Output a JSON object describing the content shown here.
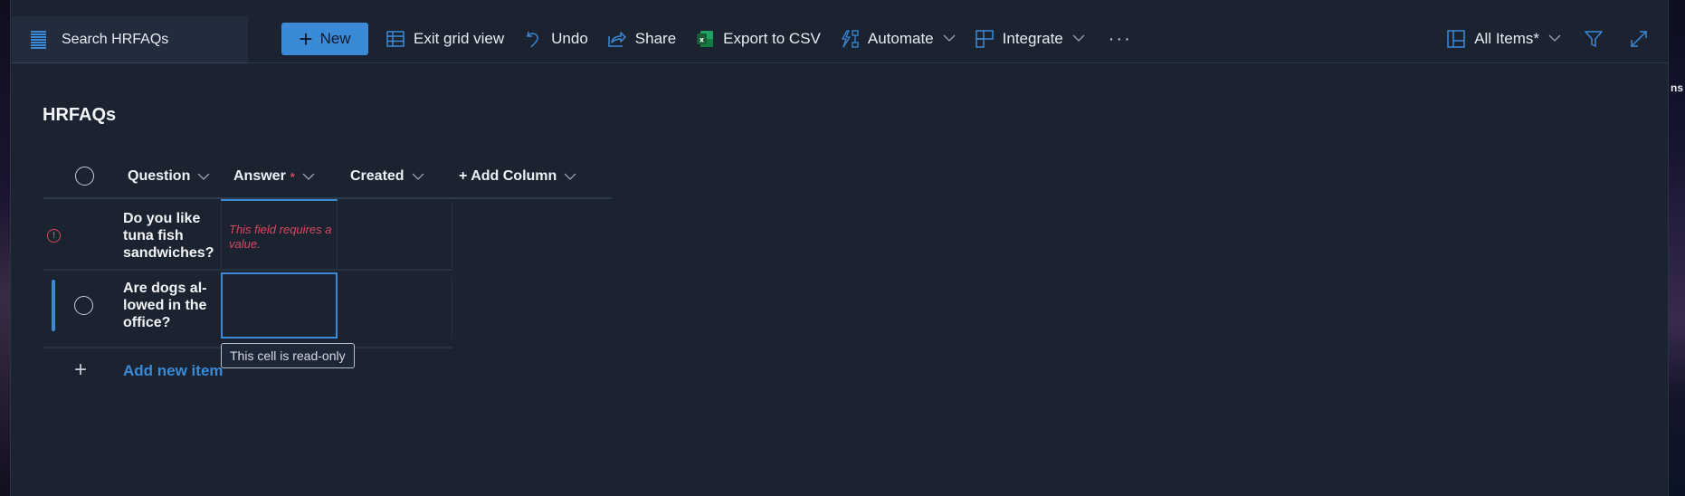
{
  "search": {
    "label": "Search HRFAQs"
  },
  "toolbar": {
    "new_label": "New",
    "exit_grid_label": "Exit grid view",
    "undo_label": "Undo",
    "share_label": "Share",
    "export_label": "Export to CSV",
    "automate_label": "Automate",
    "integrate_label": "Integrate",
    "more_label": "···",
    "view_label": "All Items*"
  },
  "page": {
    "title": "HRFAQs"
  },
  "grid": {
    "columns": [
      {
        "label": "Question",
        "required": false
      },
      {
        "label": "Answer",
        "required": true,
        "required_mark": "*"
      },
      {
        "label": "Created",
        "required": false
      },
      {
        "label": "+ Add Column",
        "required": false
      }
    ],
    "rows": [
      {
        "question": "Do you like tuna fish sandwiches?",
        "answer": "",
        "created": "",
        "error": "This field requires a value.",
        "status": "error"
      },
      {
        "question": "Are dogs al-lowed in the office?",
        "answer": "",
        "created": "",
        "status": "selected"
      }
    ],
    "add_item_label": "Add new item",
    "tooltip": "This cell is read-only"
  },
  "desktop": {
    "partial_text": "ns"
  },
  "colors": {
    "accent": "#3a8ad8",
    "error": "#d9485f",
    "background": "#1b2230"
  }
}
